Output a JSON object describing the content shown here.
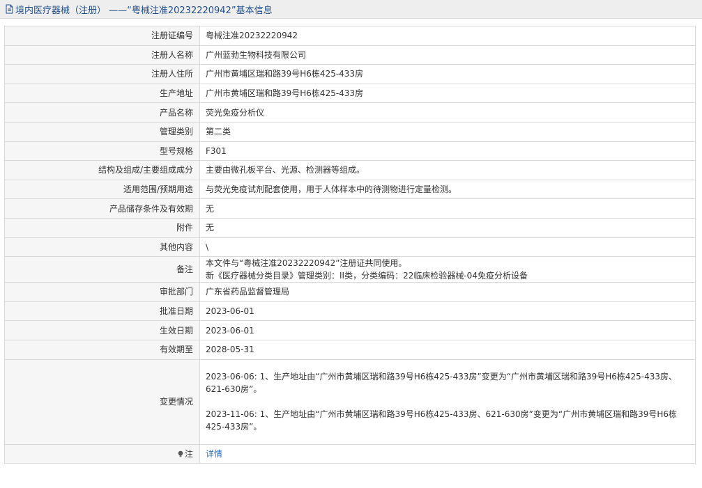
{
  "header": {
    "title": "境内医疗器械（注册） ——“粤械注准20232220942”基本信息"
  },
  "rows": [
    {
      "label": "注册证编号",
      "value": "粤械注准20232220942"
    },
    {
      "label": "注册人名称",
      "value": "广州蓝勃生物科技有限公司"
    },
    {
      "label": "注册人住所",
      "value": "广州市黄埔区瑞和路39号H6栋425-433房"
    },
    {
      "label": "生产地址",
      "value": "广州市黄埔区瑞和路39号H6栋425-433房"
    },
    {
      "label": "产品名称",
      "value": "荧光免疫分析仪"
    },
    {
      "label": "管理类别",
      "value": "第二类"
    },
    {
      "label": "型号规格",
      "value": "F301"
    },
    {
      "label": "结构及组成/主要组成成分",
      "value": "主要由微孔板平台、光源、检测器等组成。"
    },
    {
      "label": "适用范围/预期用途",
      "value": "与荧光免疫试剂配套使用，用于人体样本中的待测物进行定量检测。"
    },
    {
      "label": "产品储存条件及有效期",
      "value": "无"
    },
    {
      "label": "附件",
      "value": "无"
    },
    {
      "label": "其他内容",
      "value": "\\"
    },
    {
      "label": "备注",
      "value": "本文件与“粤械注准20232220942”注册证共同使用。\n新《医疗器械分类目录》管理类别：II类，分类编码：22临床检验器械-04免疫分析设备"
    },
    {
      "label": "审批部门",
      "value": "广东省药品监督管理局"
    },
    {
      "label": "批准日期",
      "value": "2023-06-01"
    },
    {
      "label": "生效日期",
      "value": "2023-06-01"
    },
    {
      "label": "有效期至",
      "value": "2028-05-31"
    }
  ],
  "changes": {
    "label": "变更情况",
    "entries": [
      "2023-06-06: 1、生产地址由“广州市黄埔区瑞和路39号H6栋425-433房”变更为“广州市黄埔区瑞和路39号H6栋425-433房、621-630房”。",
      "2023-11-06: 1、生产地址由“广州市黄埔区瑞和路39号H6栋425-433房、621-630房”变更为“广州市黄埔区瑞和路39号H6栋425-433房”。"
    ]
  },
  "note": {
    "label": "注",
    "link": "详情",
    "icon": "bulb-icon"
  },
  "colors": {
    "header_text": "#1f4e8c",
    "link": "#2e6fb6",
    "label_bg": "#f6f6f6",
    "border": "#d9d9d9"
  }
}
